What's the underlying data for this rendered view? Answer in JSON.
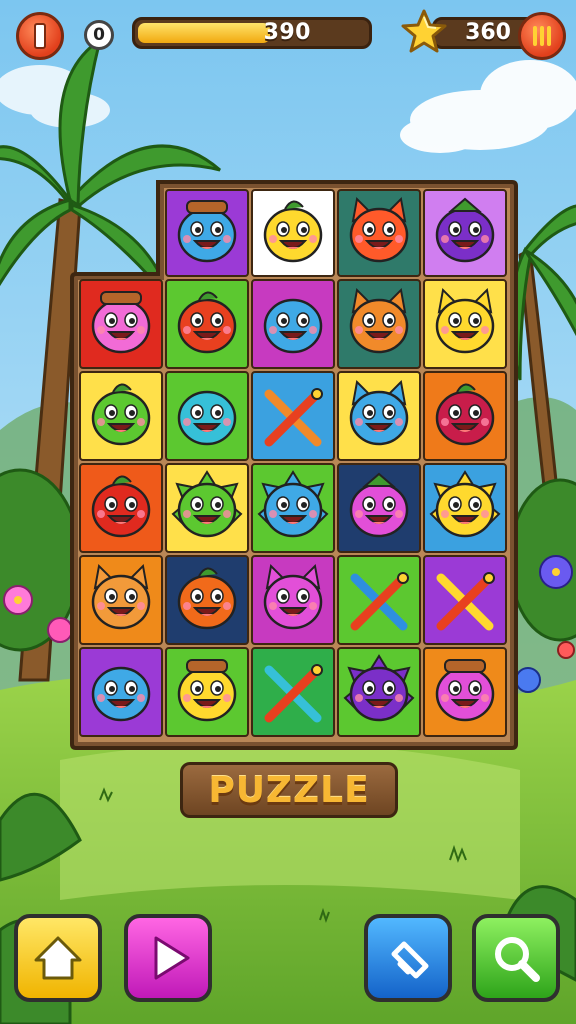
{
  "hud": {
    "left_counter": "0",
    "progress_value": "390",
    "progress_fraction": 0.58,
    "score_value": "360",
    "left_button_icon": "exclamation-icon",
    "right_button_icon": "pause-icon",
    "score_icon": "star-icon"
  },
  "board": {
    "top_row": [
      {
        "name": "blue-bucket-hat-creature",
        "bg": "#9b3ad6",
        "body": "#3fa9e6"
      },
      {
        "name": "yellow-acorn-creature",
        "bg": "#ffffff",
        "body": "#ffd92e"
      },
      {
        "name": "red-cat-creature",
        "bg": "#2f7a6a",
        "body": "#ff5a2a"
      },
      {
        "name": "purple-eggplant-creature",
        "bg": "#d07ef0",
        "body": "#7b2fc8"
      }
    ],
    "rows": [
      [
        {
          "name": "pink-hair-creature",
          "bg": "#e02a1f",
          "body": "#f26bd6"
        },
        {
          "name": "red-tomato-creature",
          "bg": "#5cc830",
          "body": "#e8401f"
        },
        {
          "name": "blue-blob-creature",
          "bg": "#c73ac0",
          "body": "#3fa9e6"
        },
        {
          "name": "orange-cat-creature",
          "bg": "#2f7a6a",
          "body": "#f18a2a"
        },
        {
          "name": "yellow-fox-creature",
          "bg": "#ffe04a",
          "body": "#ffd92e"
        }
      ],
      [
        {
          "name": "green-turtle-creature",
          "bg": "#ffe04a",
          "body": "#5cc830"
        },
        {
          "name": "teal-blob-creature",
          "bg": "#5cc830",
          "body": "#36c0d8"
        },
        {
          "name": "crossed-pencils-orange",
          "bg": "#3ba1e0",
          "body": "#f18a2a"
        },
        {
          "name": "blue-cat-creature",
          "bg": "#ffe04a",
          "body": "#3fa9e6"
        },
        {
          "name": "crimson-berry-creature",
          "bg": "#ef7a1a",
          "body": "#c81d4a"
        }
      ],
      [
        {
          "name": "red-strawberry-creature",
          "bg": "#ef5a1a",
          "body": "#e02a1f"
        },
        {
          "name": "green-spiky-creature",
          "bg": "#ffe04a",
          "body": "#5cc830"
        },
        {
          "name": "blue-spiky-creature",
          "bg": "#5cc830",
          "body": "#3fa9e6"
        },
        {
          "name": "magenta-eggplant-creature",
          "bg": "#1f3d6e",
          "body": "#e24fd8"
        },
        {
          "name": "yellow-star-creature",
          "bg": "#3ba1e0",
          "body": "#ffd92e"
        }
      ],
      [
        {
          "name": "orange-fox-creature",
          "bg": "#ef8a1a",
          "body": "#f29a3a"
        },
        {
          "name": "orange-pumpkin-creature",
          "bg": "#1f3d6e",
          "body": "#f16a1a"
        },
        {
          "name": "magenta-cat-creature",
          "bg": "#c73ac0",
          "body": "#e24fd8"
        },
        {
          "name": "crossed-pencils-blue",
          "bg": "#5cc830",
          "body": "#2e8fe0"
        },
        {
          "name": "crossed-pencils-yellow",
          "bg": "#9b3ad6",
          "body": "#ffd92e"
        }
      ],
      [
        {
          "name": "blue-fish-creature",
          "bg": "#9b3ad6",
          "body": "#3fa9e6"
        },
        {
          "name": "yellow-chick-creature",
          "bg": "#5cc830",
          "body": "#ffd92e"
        },
        {
          "name": "crossed-pencils-teal",
          "bg": "#2fae4a",
          "body": "#36c0d8"
        },
        {
          "name": "purple-spiky-creature",
          "bg": "#5cc830",
          "body": "#7b2fc8"
        },
        {
          "name": "magenta-pot-creature",
          "bg": "#ef8a1a",
          "body": "#e24fd8"
        }
      ]
    ]
  },
  "footer": {
    "puzzle_label": "PUZZLE",
    "buttons": [
      "home-icon",
      "play-icon",
      "hint-icon",
      "magnifier-icon"
    ]
  }
}
